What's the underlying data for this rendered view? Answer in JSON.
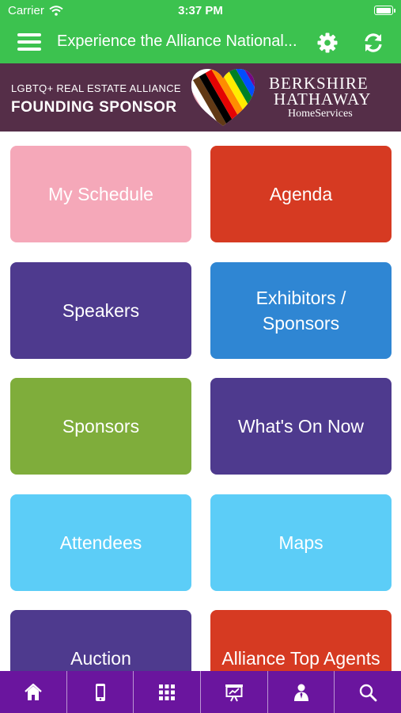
{
  "status_bar": {
    "carrier": "Carrier",
    "time": "3:37 PM",
    "battery_level": 1.0
  },
  "nav_bar": {
    "title": "Experience the Alliance National..."
  },
  "banner": {
    "text_line1": "LGBTQ+ REAL ESTATE ALLIANCE",
    "text_line2": "FOUNDING SPONSOR",
    "brand_line1": "BERKSHIRE",
    "brand_line2": "HATHAWAY",
    "brand_line3": "HomeServices",
    "background_color": "#552e48"
  },
  "tiles": [
    {
      "label": "My Schedule",
      "color": "#f5a8b9"
    },
    {
      "label": "Agenda",
      "color": "#d63a22"
    },
    {
      "label": "Speakers",
      "color": "#4e3a8e"
    },
    {
      "label": "Exhibitors / Sponsors",
      "color": "#2f86d3"
    },
    {
      "label": "Sponsors",
      "color": "#7fad3b"
    },
    {
      "label": "What's On Now",
      "color": "#4e3a8e"
    },
    {
      "label": "Attendees",
      "color": "#5ccdf7"
    },
    {
      "label": "Maps",
      "color": "#5ccdf7"
    },
    {
      "label": "Auction",
      "color": "#4e3a8e"
    },
    {
      "label": "Alliance Top Agents",
      "color": "#d63a22"
    }
  ],
  "tabbar": {
    "background_color": "#6a159e",
    "items": [
      {
        "icon": "home-icon"
      },
      {
        "icon": "mobile-icon"
      },
      {
        "icon": "grid-icon"
      },
      {
        "icon": "presentation-icon"
      },
      {
        "icon": "person-icon"
      },
      {
        "icon": "search-icon"
      }
    ]
  },
  "theme": {
    "accent": "#3cc24f"
  }
}
